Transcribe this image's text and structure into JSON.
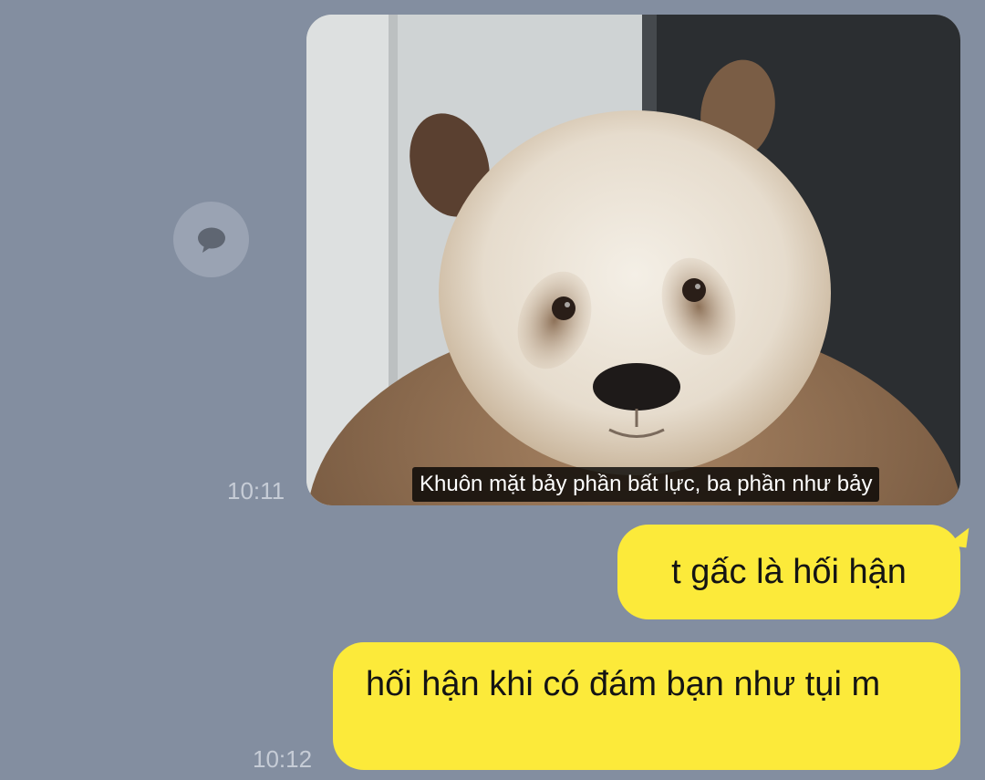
{
  "chat": {
    "image_message": {
      "caption": "Khuôn mặt bảy phần bất lực, ba phần như bảy",
      "timestamp": "10:11",
      "image_subject": "panda-face"
    },
    "messages": [
      {
        "text": "t gấc là hối hận"
      },
      {
        "text": "hối hận khi có đám bạn như tụi m",
        "timestamp": "10:12"
      }
    ]
  },
  "colors": {
    "background": "#838ea0",
    "bubble": "#fcea3a",
    "timestamp": "#c6ccd6"
  },
  "icons": {
    "reply": "speech-bubble-icon"
  }
}
